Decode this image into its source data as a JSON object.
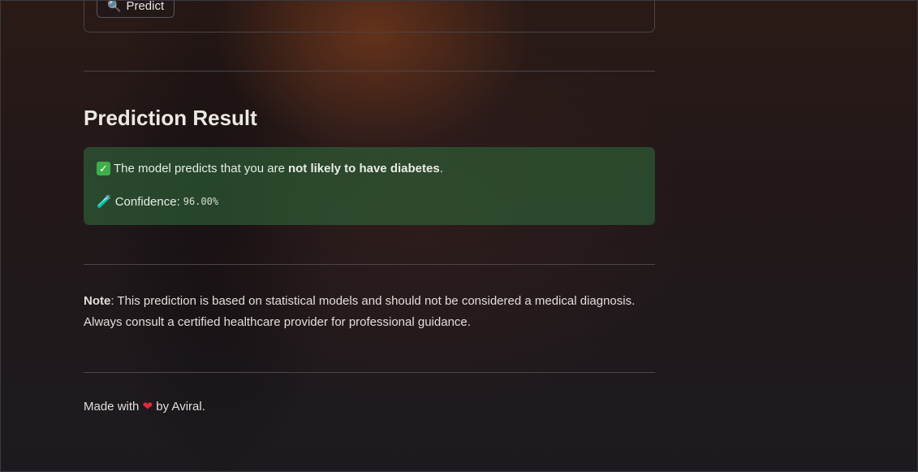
{
  "form": {
    "predict_label": "Predict",
    "predict_icon": "magnifier-icon"
  },
  "result": {
    "title": "Prediction Result",
    "line1_icon": "check-mark-icon",
    "line1_prefix": "The model predicts that you are",
    "line1_bold": "not likely to have diabetes",
    "line1_suffix": ".",
    "line2_icon": "test-tube-icon",
    "confidence_label": "Confidence:",
    "confidence_value": "96.00%",
    "box_color": "#2e663a"
  },
  "note": {
    "label": "Note",
    "text": ": This prediction is based on statistical models and should not be considered a medical diagnosis. Always consult a certified healthcare provider for professional guidance."
  },
  "footer": {
    "prefix": "Made with",
    "heart_icon": "heart-icon",
    "suffix": "by Aviral."
  }
}
